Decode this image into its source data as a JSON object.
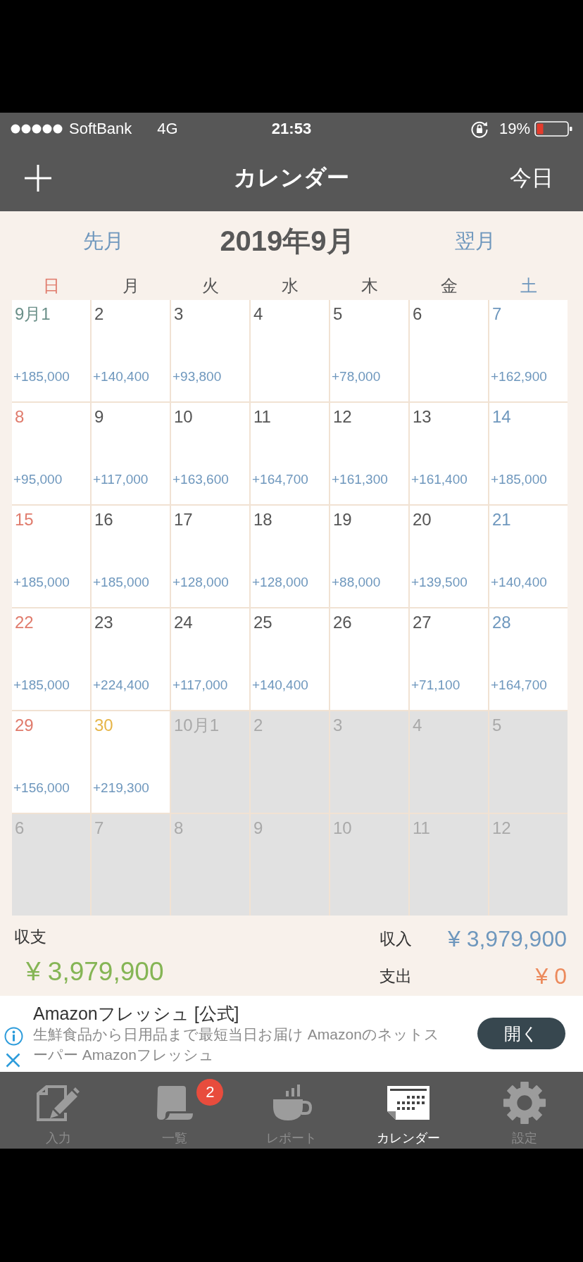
{
  "status_bar": {
    "carrier": "SoftBank",
    "network": "4G",
    "time": "21:53",
    "battery_percent": "19%"
  },
  "nav_bar": {
    "title": "カレンダー",
    "today_button": "今日"
  },
  "month_header": {
    "prev": "先月",
    "title": "2019年9月",
    "next": "翌月"
  },
  "weekdays": [
    {
      "label": "日",
      "kind": "sunday"
    },
    {
      "label": "月",
      "kind": "weekday"
    },
    {
      "label": "火",
      "kind": "weekday"
    },
    {
      "label": "水",
      "kind": "weekday"
    },
    {
      "label": "木",
      "kind": "weekday"
    },
    {
      "label": "金",
      "kind": "weekday"
    },
    {
      "label": "土",
      "kind": "saturday"
    }
  ],
  "weeks": [
    [
      {
        "date": "9月1",
        "amount": "+185,000",
        "kind": "month_start"
      },
      {
        "date": "2",
        "amount": "+140,400",
        "kind": "weekday"
      },
      {
        "date": "3",
        "amount": "+93,800",
        "kind": "weekday"
      },
      {
        "date": "4",
        "kind": "weekday"
      },
      {
        "date": "5",
        "amount": "+78,000",
        "kind": "weekday"
      },
      {
        "date": "6",
        "kind": "weekday"
      },
      {
        "date": "7",
        "amount": "+162,900",
        "kind": "saturday"
      }
    ],
    [
      {
        "date": "8",
        "amount": "+95,000",
        "kind": "sunday"
      },
      {
        "date": "9",
        "amount": "+117,000",
        "kind": "weekday"
      },
      {
        "date": "10",
        "amount": "+163,600",
        "kind": "weekday"
      },
      {
        "date": "11",
        "amount": "+164,700",
        "kind": "weekday"
      },
      {
        "date": "12",
        "amount": "+161,300",
        "kind": "weekday"
      },
      {
        "date": "13",
        "amount": "+161,400",
        "kind": "weekday"
      },
      {
        "date": "14",
        "amount": "+185,000",
        "kind": "saturday"
      }
    ],
    [
      {
        "date": "15",
        "amount": "+185,000",
        "kind": "sunday"
      },
      {
        "date": "16",
        "amount": "+185,000",
        "kind": "weekday"
      },
      {
        "date": "17",
        "amount": "+128,000",
        "kind": "weekday"
      },
      {
        "date": "18",
        "amount": "+128,000",
        "kind": "weekday"
      },
      {
        "date": "19",
        "amount": "+88,000",
        "kind": "weekday"
      },
      {
        "date": "20",
        "amount": "+139,500",
        "kind": "weekday"
      },
      {
        "date": "21",
        "amount": "+140,400",
        "kind": "saturday"
      }
    ],
    [
      {
        "date": "22",
        "amount": "+185,000",
        "kind": "sunday"
      },
      {
        "date": "23",
        "amount": "+224,400",
        "kind": "weekday"
      },
      {
        "date": "24",
        "amount": "+117,000",
        "kind": "weekday"
      },
      {
        "date": "25",
        "amount": "+140,400",
        "kind": "weekday"
      },
      {
        "date": "26",
        "kind": "weekday"
      },
      {
        "date": "27",
        "amount": "+71,100",
        "kind": "weekday"
      },
      {
        "date": "28",
        "amount": "+164,700",
        "kind": "saturday"
      }
    ],
    [
      {
        "date": "29",
        "amount": "+156,000",
        "kind": "sunday"
      },
      {
        "date": "30",
        "amount": "+219,300",
        "kind": "today"
      },
      {
        "date": "10月1",
        "kind": "other_month"
      },
      {
        "date": "2",
        "kind": "other_month"
      },
      {
        "date": "3",
        "kind": "other_month"
      },
      {
        "date": "4",
        "kind": "other_month"
      },
      {
        "date": "5",
        "kind": "other_month"
      }
    ],
    [
      {
        "date": "6",
        "kind": "other_month"
      },
      {
        "date": "7",
        "kind": "other_month"
      },
      {
        "date": "8",
        "kind": "other_month"
      },
      {
        "date": "9",
        "kind": "other_month"
      },
      {
        "date": "10",
        "kind": "other_month"
      },
      {
        "date": "11",
        "kind": "other_month"
      },
      {
        "date": "12",
        "kind": "other_month"
      }
    ]
  ],
  "totals": {
    "balance_label": "収支",
    "balance": "¥ 3,979,900",
    "income_label": "収入",
    "income": "¥ 3,979,900",
    "expense_label": "支出",
    "expense": "¥ 0"
  },
  "ad": {
    "title": "Amazonフレッシュ [公式]",
    "description": "生鮮食品から日用品まで最短当日お届け Amazonのネットスーパー Amazonフレッシュ",
    "button": "開く"
  },
  "tab_bar": [
    {
      "label": "入力",
      "kind": "input",
      "selected": false
    },
    {
      "label": "一覧",
      "kind": "list",
      "selected": false,
      "badge": "2"
    },
    {
      "label": "レポート",
      "kind": "report",
      "selected": false
    },
    {
      "label": "カレンダー",
      "kind": "calendar",
      "selected": true
    },
    {
      "label": "設定",
      "kind": "settings",
      "selected": false
    }
  ]
}
